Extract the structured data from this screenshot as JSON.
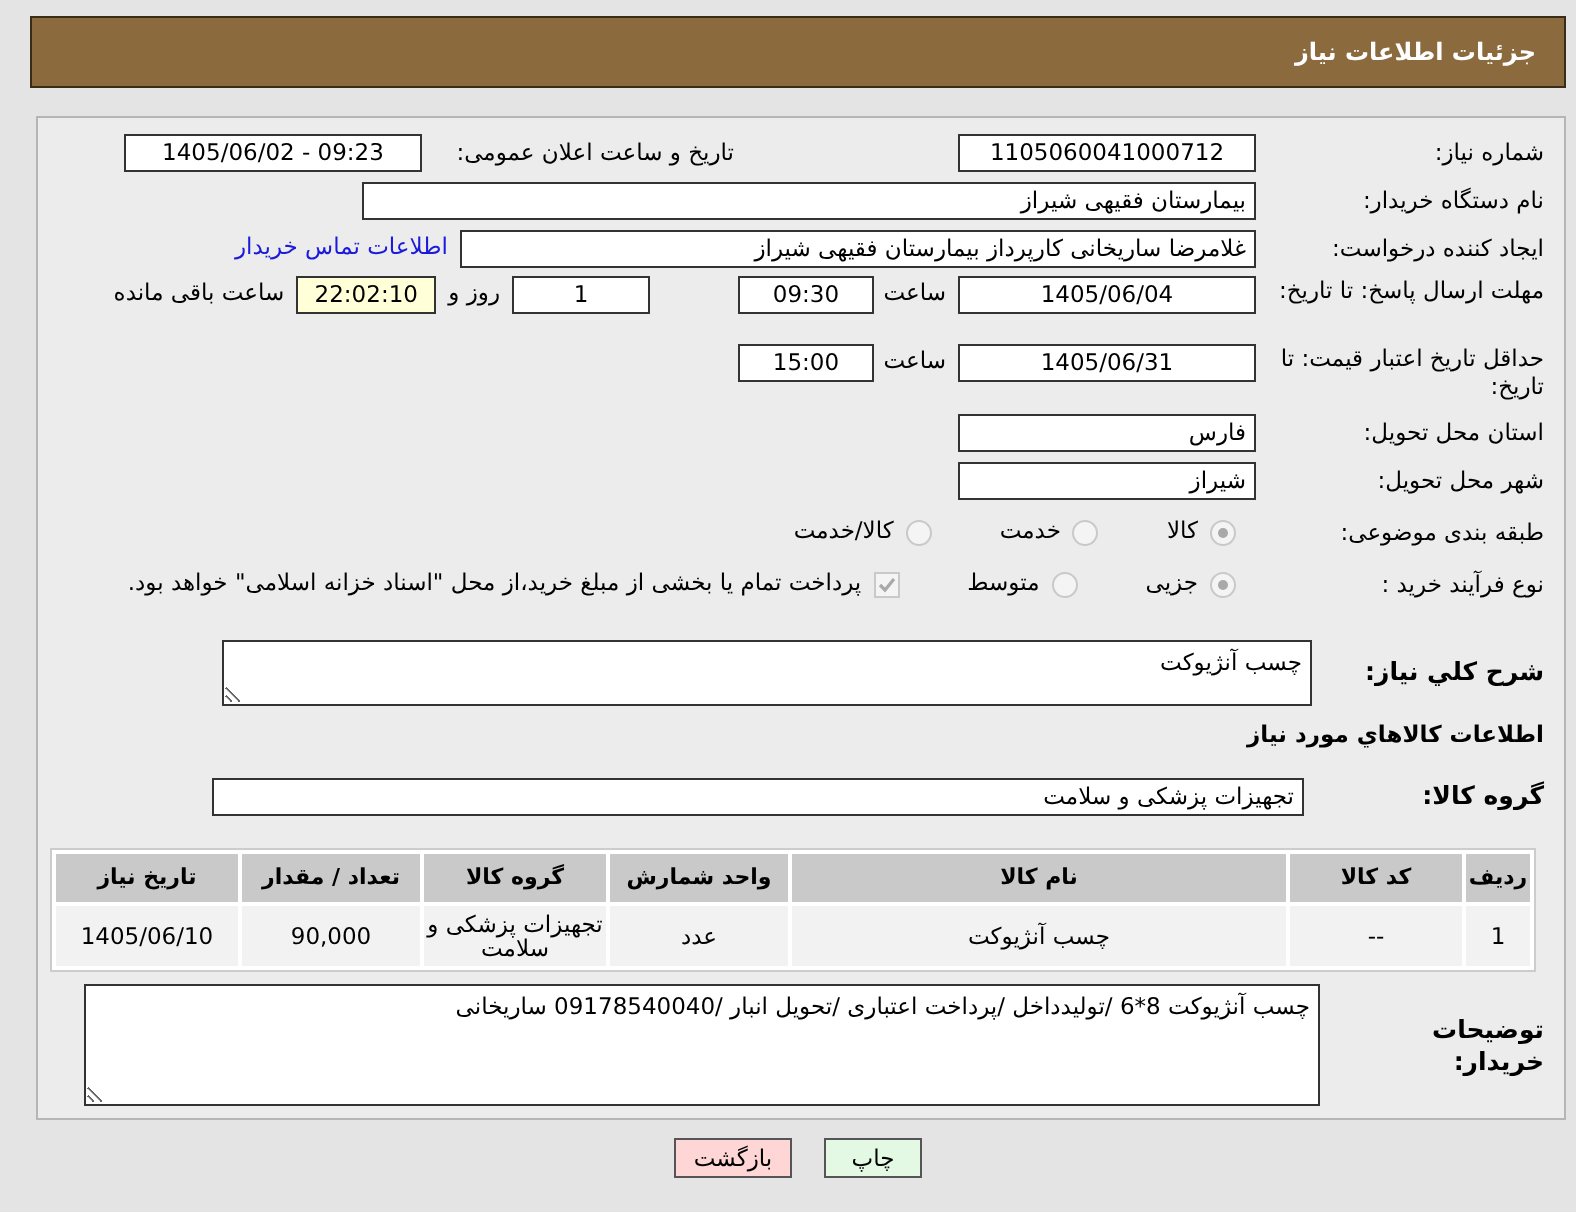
{
  "page_title": "جزئیات اطلاعات نیاز",
  "need_number": {
    "label": "شماره نیاز:",
    "value": "1105060041000712"
  },
  "announce": {
    "label": "تاریخ و ساعت اعلان عمومی:",
    "value": "1405/06/02 - 09:23"
  },
  "buyer_org": {
    "label": "نام دستگاه خریدار:",
    "value": "بیمارستان فقیهی شیراز"
  },
  "requester": {
    "label": "ایجاد کننده درخواست:",
    "value": "غلامرضا ساریخانی کارپرداز بیمارستان فقیهی شیراز",
    "link": "اطلاعات تماس خریدار"
  },
  "response_deadline": {
    "label": "مهلت ارسال پاسخ: تا تاریخ:",
    "date": "1405/06/04",
    "time_label": "ساعت",
    "time": "09:30",
    "days": "1",
    "days_label": "روز و",
    "remaining": "22:02:10",
    "remaining_label": "ساعت باقی مانده"
  },
  "price_validity": {
    "label": "حداقل تاریخ اعتبار قیمت: تا تاریخ:",
    "date": "1405/06/31",
    "time_label": "ساعت",
    "time": "15:00"
  },
  "province": {
    "label": "استان محل تحویل:",
    "value": "فارس"
  },
  "city": {
    "label": "شهر محل تحویل:",
    "value": "شیراز"
  },
  "category": {
    "label": "طبقه بندی موضوعی:",
    "options": [
      {
        "label": "کالا",
        "selected": true
      },
      {
        "label": "خدمت",
        "selected": false
      },
      {
        "label": "کالا/خدمت",
        "selected": false
      }
    ]
  },
  "purchase_type": {
    "label": "نوع فرآیند خرید :",
    "options": [
      {
        "label": "جزیی",
        "selected": true
      },
      {
        "label": "متوسط",
        "selected": false
      }
    ],
    "treasury": {
      "label": "پرداخت تمام یا بخشی از مبلغ خرید،از محل \"اسناد خزانه اسلامی\" خواهد بود.",
      "checked": true
    }
  },
  "description": {
    "label": "شرح كلي نیاز:",
    "value": "چسب آنژیوکت"
  },
  "goods_heading": "اطلاعات كالاهاي مورد نياز",
  "goods_group": {
    "label": "گروه کالا:",
    "value": "تجهیزات پزشکی و سلامت"
  },
  "table": {
    "columns": [
      "ردیف",
      "کد کالا",
      "نام کالا",
      "واحد شمارش",
      "گروه کالا",
      "تعداد / مقدار",
      "تاریخ نیاز"
    ],
    "rows": [
      [
        "1",
        "--",
        "چسب آنژیوکت",
        "عدد",
        "تجهیزات پزشکی و سلامت",
        "90,000",
        "1405/06/10"
      ]
    ]
  },
  "buyer_notes": {
    "label": "توضیحات خریدار:",
    "value": "چسب آنژیوکت 8*6 /تولیدداخل /پرداخت اعتباری /تحویل انبار /09178540040 ساریخانی"
  },
  "buttons": [
    {
      "label": "چاپ",
      "kind": "print"
    },
    {
      "label": "بازگشت",
      "kind": "back"
    }
  ]
}
